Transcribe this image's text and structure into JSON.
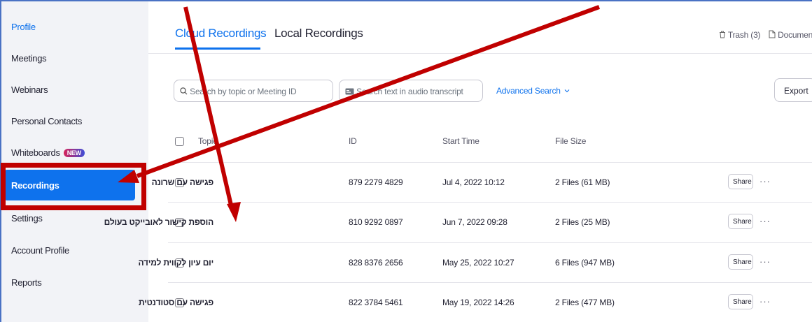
{
  "sidebar": {
    "items": [
      {
        "label": "Profile"
      },
      {
        "label": "Meetings"
      },
      {
        "label": "Webinars"
      },
      {
        "label": "Personal Contacts"
      },
      {
        "label": "Whiteboards",
        "badge": "NEW"
      },
      {
        "label": "Recordings"
      },
      {
        "label": "Settings"
      },
      {
        "label": "Account Profile"
      },
      {
        "label": "Reports"
      }
    ],
    "active_item": "Recordings"
  },
  "tabs": [
    {
      "label": "Cloud Recordings",
      "active": true
    },
    {
      "label": "Local Recordings",
      "active": false
    }
  ],
  "top_links": {
    "trash": "Trash (3)",
    "document": "Document"
  },
  "search": {
    "topic_placeholder": "Search by topic or Meeting ID",
    "transcript_placeholder": "Search text in audio transcript",
    "advanced_label": "Advanced Search"
  },
  "export_label": "Export",
  "table": {
    "headers": {
      "topic": "Topic",
      "id": "ID",
      "start_time": "Start Time",
      "file_size": "File Size"
    },
    "rows": [
      {
        "topic": "פגישה עם שרונה",
        "id": "879 2279 4829",
        "start_time": "Jul 4, 2022 10:12",
        "file_size": "2 Files (61 MB)"
      },
      {
        "topic": "הוספת קישור לאובייקט בעולם",
        "id": "810 9292 0897",
        "start_time": "Jun 7, 2022 09:28",
        "file_size": "2 Files (25 MB)"
      },
      {
        "topic": "יום עיון לקווית למידה",
        "id": "828 8376 2656",
        "start_time": "May 25, 2022 10:27",
        "file_size": "6 Files (947 MB)"
      },
      {
        "topic": "פגישה עם סטודנטית",
        "id": "822 3784 5461",
        "start_time": "May 19, 2022 14:26",
        "file_size": "2 Files (477 MB)"
      }
    ],
    "share_label": "Share",
    "more_label": "···"
  },
  "colors": {
    "accent": "#0e72ed",
    "annotation_red": "#c00000",
    "sidebar_bg": "#f2f3f7"
  }
}
